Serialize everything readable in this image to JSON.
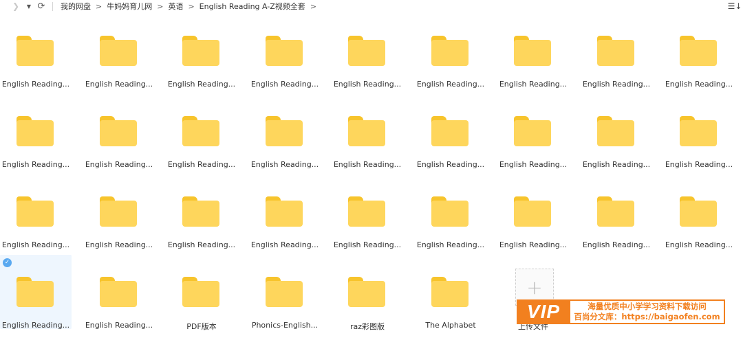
{
  "nav": {
    "forward_icon": "chevron-right-icon",
    "dropdown_icon": "caret-down-icon",
    "refresh_icon": "refresh-icon",
    "sort_icon": "sort-list-icon"
  },
  "breadcrumb": [
    "我的网盘",
    "牛妈妈育儿网",
    "英语",
    "English Reading A-Z视频全套"
  ],
  "breadcrumb_trailing_sep": ">",
  "folders": [
    "English Reading...",
    "English Reading...",
    "English Reading...",
    "English Reading...",
    "English Reading...",
    "English Reading...",
    "English Reading...",
    "English Reading...",
    "English Reading...",
    "English Reading...",
    "English Reading...",
    "English Reading...",
    "English Reading...",
    "English Reading...",
    "English Reading...",
    "English Reading...",
    "English Reading...",
    "English Reading...",
    "English Reading...",
    "English Reading...",
    "English Reading...",
    "English Reading...",
    "English Reading...",
    "English Reading...",
    "English Reading...",
    "English Reading...",
    "English Reading...",
    "English Reading...",
    "English Reading...",
    "PDF版本",
    "Phonics-English...",
    "raz彩图版",
    "The Alphabet"
  ],
  "selected_index": 27,
  "upload_label": "上传文件",
  "colors": {
    "folder_front": "#fed65c",
    "folder_back": "#f7c42c",
    "selected_bg": "#eef6fe",
    "vip_orange": "#f2801f"
  },
  "watermark": {
    "logo": "VIP",
    "line1": "海量优质中小学学习资料下载访问",
    "line2": "百尚分文库：https://baigaofen.com"
  }
}
